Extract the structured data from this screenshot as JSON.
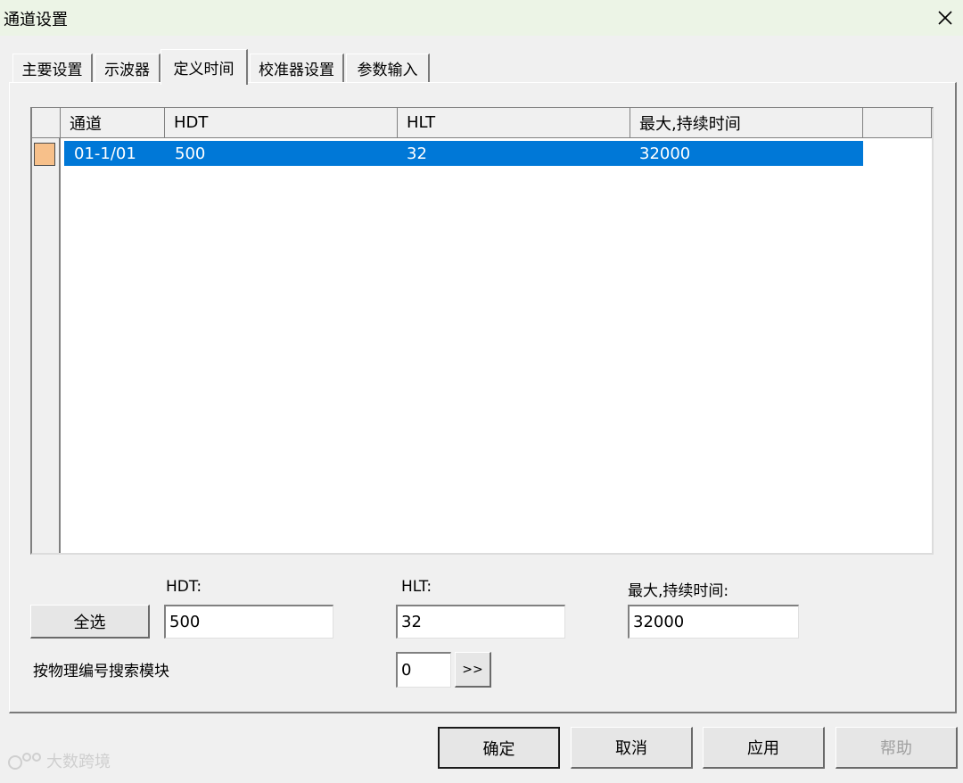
{
  "window": {
    "title": "通道设置"
  },
  "tabs": [
    {
      "label": "主要设置"
    },
    {
      "label": "示波器"
    },
    {
      "label": "定义时间"
    },
    {
      "label": "校准器设置"
    },
    {
      "label": "参数输入"
    }
  ],
  "active_tab": "定义时间",
  "table": {
    "headers": [
      "通道",
      "HDT",
      "HLT",
      "最大,持续时间"
    ],
    "rows": [
      {
        "channel": "01-1/01",
        "hdt": "500",
        "hlt": "32",
        "max_duration": "32000",
        "selected": true
      }
    ]
  },
  "form": {
    "hdt_label": "HDT:",
    "hlt_label": "HLT:",
    "max_label": "最大,持续时间:",
    "select_all": "全选",
    "hdt_value": "500",
    "hlt_value": "32",
    "max_value": "32000",
    "search_label": "按物理编号搜索模块",
    "search_value": "0",
    "go_label": ">>"
  },
  "footer": {
    "ok": "确定",
    "cancel": "取消",
    "apply": "应用",
    "help": "帮助"
  },
  "watermark": "大数跨境",
  "colors": {
    "selection": "#0078d7",
    "row_marker": "#f7c08a",
    "titlebar": "#ecf4e6"
  }
}
